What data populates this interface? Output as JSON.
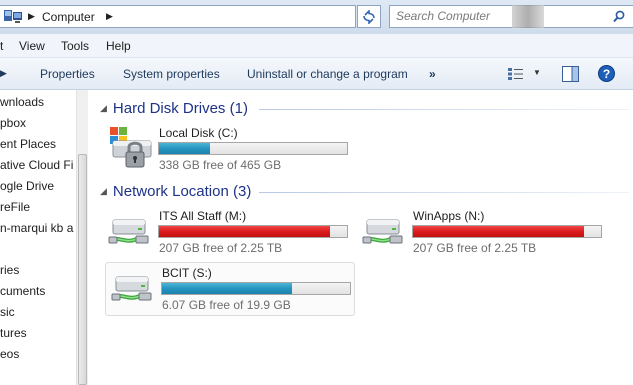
{
  "address": {
    "crumb": "Computer",
    "search_placeholder": "Search Computer"
  },
  "menu": [
    "t",
    "View",
    "Tools",
    "Help"
  ],
  "commands": {
    "properties": "Properties",
    "system_properties": "System properties",
    "uninstall": "Uninstall or change a program",
    "more": "»"
  },
  "nav": [
    "wnloads",
    "pbox",
    "ent Places",
    "ative Cloud Fi",
    "ogle Drive",
    "reFile",
    "n-marqui kb a",
    "",
    "ries",
    "cuments",
    "sic",
    "tures",
    "eos"
  ],
  "groups": {
    "hard": "Hard Disk Drives (1)",
    "network": "Network Location (3)"
  },
  "drives": {
    "local": {
      "name": "Local Disk (C:)",
      "free": "338 GB free of 465 GB",
      "used_fraction": 0.27,
      "bar": "blue"
    },
    "its": {
      "name": "ITS All Staff (M:)",
      "free": "207 GB free of 2.25 TB",
      "used_fraction": 0.91,
      "bar": "red"
    },
    "winapps": {
      "name": "WinApps (N:)",
      "free": "207 GB free of 2.25 TB",
      "used_fraction": 0.91,
      "bar": "red"
    },
    "bcit": {
      "name": "BCIT (S:)",
      "free": "6.07 GB free of 19.9 GB",
      "used_fraction": 0.69,
      "bar": "blue"
    }
  }
}
